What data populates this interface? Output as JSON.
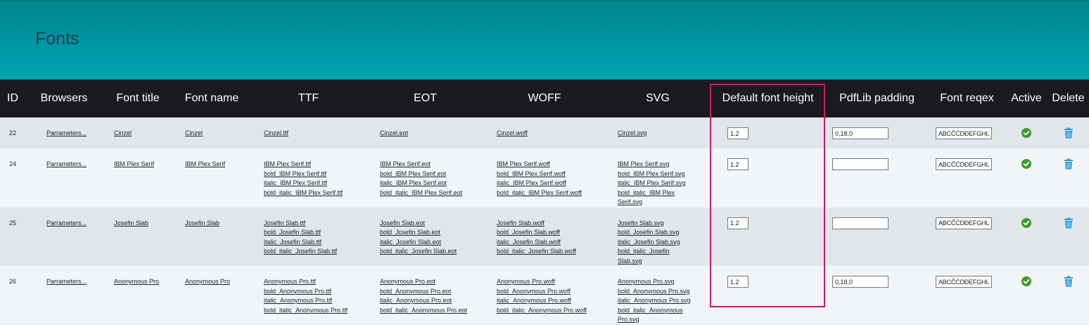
{
  "header": {
    "title": "Fonts"
  },
  "columns": {
    "id": "ID",
    "browsers": "Browsers",
    "font_title": "Font title",
    "font_name": "Font name",
    "ttf": "TTF",
    "eot": "EOT",
    "woff": "WOFF",
    "svg": "SVG",
    "default_height": "Default font height",
    "pdflib_padding": "PdfLib padding",
    "font_regex": "Font reqex",
    "active": "Active",
    "delete": "Delete"
  },
  "icons": {
    "active": "check-circle-icon",
    "delete": "trash-icon",
    "active_color": "#3f9a2a",
    "delete_color": "#2e9ad6"
  },
  "rows": [
    {
      "id": "22",
      "browsers": "Parrameters...",
      "font_title": "Cinzel",
      "font_name": "Cinzel",
      "ttf": [
        "Cinzel.ttf"
      ],
      "eot": [
        "Cinzel.eot"
      ],
      "woff": [
        "Cinzel.woff"
      ],
      "svg": [
        "Cinzel.svg"
      ],
      "default_height": "1.2",
      "pdflib_padding": "0,18,0",
      "font_regex": "ABCČĆDĐEFGHIJK"
    },
    {
      "id": "24",
      "browsers": "Parrameters...",
      "font_title": "IBM Plex Serif",
      "font_name": "IBM Plex Serif",
      "ttf": [
        "IBM Plex Serif.ttf",
        "bold_IBM Plex Serif.ttf",
        "italic_IBM Plex Serif.ttf",
        "bold_italic_IBM Plex Serif.ttf"
      ],
      "eot": [
        "IBM Plex Serif.eot",
        "bold_IBM Plex Serif.eot",
        "italic_IBM Plex Serif.eot",
        "bold_italic_IBM Plex Serif.eot"
      ],
      "woff": [
        "IBM Plex Serif.woff",
        "bold_IBM Plex Serif.woff",
        "italic_IBM Plex Serif.woff",
        "bold_italic_IBM Plex Serif.woff"
      ],
      "svg": [
        "IBM Plex Serif.svg",
        "bold_IBM Plex Serif.svg",
        "italic_IBM Plex Serif.svg",
        "bold_italic_IBM Plex Serif.svg"
      ],
      "default_height": "1.2",
      "pdflib_padding": "",
      "font_regex": "ABCČĆDĐEFGHIJK"
    },
    {
      "id": "25",
      "browsers": "Parrameters...",
      "font_title": "Josefin Slab",
      "font_name": "Josefin Slab",
      "ttf": [
        "Josefin Slab.ttf",
        "bold_Josefin Slab.ttf",
        "italic_Josefin Slab.ttf",
        "bold_italic_Josefin Slab.ttf"
      ],
      "eot": [
        "Josefin Slab.eot",
        "bold_Josefin Slab.eot",
        "italic_Josefin Slab.eot",
        "bold_italic_Josefin Slab.eot"
      ],
      "woff": [
        "Josefin Slab.woff",
        "bold_Josefin Slab.woff",
        "italic_Josefin Slab.woff",
        "bold_italic_Josefin Slab.woff"
      ],
      "svg": [
        "Josefin Slab.svg",
        "bold_Josefin Slab.svg",
        "italic_Josefin Slab.svg",
        "bold_italic_Josefin Slab.svg"
      ],
      "default_height": "1.2",
      "pdflib_padding": "",
      "font_regex": "ABCČĆDĐEFGHIJK"
    },
    {
      "id": "26",
      "browsers": "Parrameters...",
      "font_title": "Anonymous Pro",
      "font_name": "Anonymous Pro",
      "ttf": [
        "Anonymous Pro.ttf",
        "bold_Anonymous Pro.ttf",
        "italic_Anonymous Pro.ttf",
        "bold_italic_Anonymous Pro.ttf"
      ],
      "eot": [
        "Anonymous Pro.eot",
        "bold_Anonymous Pro.eot",
        "italic_Anonymous Pro.eot",
        "bold_italic_Anonymous Pro.eot"
      ],
      "woff": [
        "Anonymous Pro.woff",
        "bold_Anonymous Pro.woff",
        "italic_Anonymous Pro.woff",
        "bold_italic_Anonymous Pro.woff"
      ],
      "svg": [
        "Anonymous Pro.svg",
        "bold_Anonymous Pro.svg",
        "italic_Anonymous Pro.svg",
        "bold_italic_Anonymous Pro.svg"
      ],
      "default_height": "1.2",
      "pdflib_padding": "0,18,0",
      "font_regex": "ABCČĆDĐEFGHIJK"
    }
  ]
}
